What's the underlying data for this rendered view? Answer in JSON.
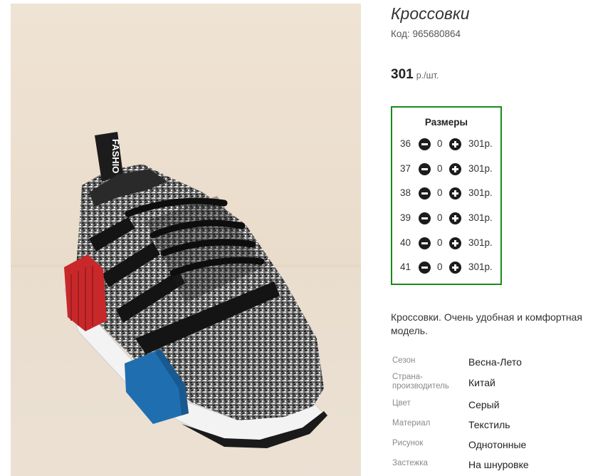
{
  "product": {
    "title": "Кроссовки",
    "code": "Код: 965680864",
    "price": "301",
    "price_unit": "р./шт.",
    "description": "Кроссовки. Очень удобная и комфортная модель."
  },
  "sizes": {
    "title": "Размеры",
    "rows": [
      {
        "size": "36",
        "qty": "0",
        "sum": "301р."
      },
      {
        "size": "37",
        "qty": "0",
        "sum": "301р."
      },
      {
        "size": "38",
        "qty": "0",
        "sum": "301р."
      },
      {
        "size": "39",
        "qty": "0",
        "sum": "301р."
      },
      {
        "size": "40",
        "qty": "0",
        "sum": "301р."
      },
      {
        "size": "41",
        "qty": "0",
        "sum": "301р."
      }
    ]
  },
  "props": [
    {
      "key": "Сезон",
      "value": "Весна-Лето"
    },
    {
      "key": "Страна-производитель",
      "value": "Китай"
    },
    {
      "key": "Цвет",
      "value": "Серый"
    },
    {
      "key": "Материал",
      "value": "Текстиль"
    },
    {
      "key": "Рисунок",
      "value": "Однотонные"
    },
    {
      "key": "Застежка",
      "value": "На шнуровке"
    }
  ],
  "image": {
    "tab_text": "FASHIO",
    "accent_red": "#c8282a",
    "accent_blue": "#1f6fb0",
    "frame_color": "#1a8a1a"
  }
}
